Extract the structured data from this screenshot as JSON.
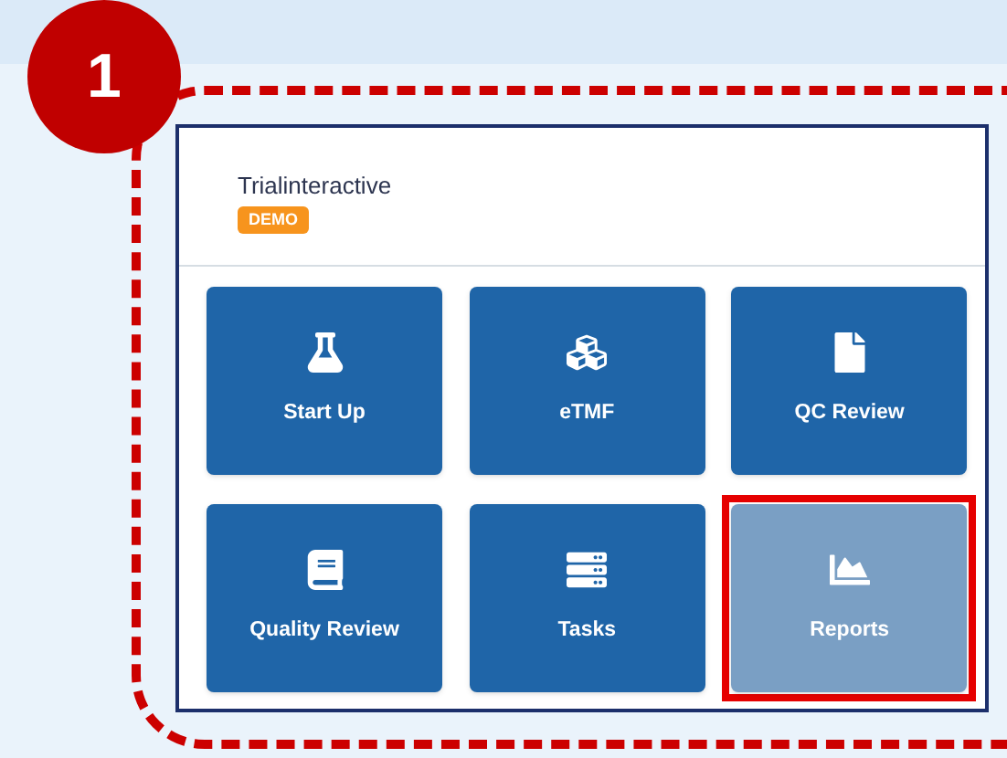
{
  "step_badge": "1",
  "app": {
    "title": "Trialinteractive",
    "badge": "DEMO"
  },
  "tiles": [
    {
      "label": "Start Up",
      "selected": false
    },
    {
      "label": "eTMF",
      "selected": false
    },
    {
      "label": "QC Review",
      "selected": false
    },
    {
      "label": "Quality Review",
      "selected": false
    },
    {
      "label": "Tasks",
      "selected": false
    },
    {
      "label": "Reports",
      "selected": true
    }
  ]
}
